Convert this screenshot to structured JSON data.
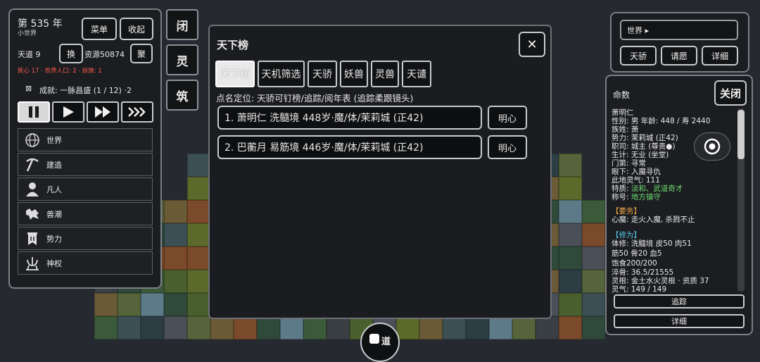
{
  "left": {
    "year": "第 535 年",
    "world_type": "小世界",
    "menu_btn": "菜单",
    "collapse_btn": "收起",
    "tiandao": "天道 9",
    "swap_btn": "换",
    "resources": "资源50874",
    "gather_btn": "聚",
    "status_line": "民心 17 · 世界人口: 2 · 妖族: 1",
    "achievement_icon": "⊠",
    "achievement": "成就: 一脉昌盛 (1 / 12) ·2",
    "menu_items": [
      {
        "label": "世界",
        "icon": "globe-icon"
      },
      {
        "label": "建造",
        "icon": "pickaxe-icon"
      },
      {
        "label": "凡人",
        "icon": "person-icon"
      },
      {
        "label": "兽潮",
        "icon": "wolf-icon"
      },
      {
        "label": "势力",
        "icon": "banner-icon"
      },
      {
        "label": "神权",
        "icon": "trident-icon"
      }
    ]
  },
  "side_buttons": [
    "闭",
    "灵",
    "筑"
  ],
  "modal": {
    "title": "天下榜",
    "close": "✕",
    "tabs": [
      "天下榜",
      "天机筛选",
      "天骄",
      "妖兽",
      "灵兽",
      "天谴"
    ],
    "subtitle": "点名定位: 天骄可钉榜/追踪/阅年表 (追踪柔跟镜头)",
    "entries": [
      {
        "text": "1. 萧明仁  洗髓境  448岁·魔/体/茉莉城 (正42)",
        "action": "明心"
      },
      {
        "text": "2. 巴蘅月  易筋境  446岁·魔/体/茉莉城 (正42)",
        "action": "明心"
      }
    ]
  },
  "right_top": {
    "world_select": "世界 ▸",
    "buttons": [
      "天骄",
      "请愿",
      "详细"
    ]
  },
  "right_panel": {
    "title": "命数",
    "close": "关闭",
    "name": "萧明仁",
    "lines": [
      "性别: 男   年龄: 448 / 寿 2440",
      "族姓: 萧",
      "势力: 茉莉城 (正42)",
      "职司: 城主 (尊贵●)",
      "生计: 无业 (坐堂)",
      "门第: 寻常",
      "眼下: 入魔寻仇",
      "此地灵气: 111"
    ],
    "trait_label": "特质: ",
    "trait_value": "淡和、武道奇才",
    "title_label": "称号: ",
    "title_value": "地方镇守",
    "task_header": "【要务】",
    "task": "心魔: 走火入魔, 杀戮不止",
    "cult_header": "【修为】",
    "cult_lines": [
      "体修: 洗髓境   皮50  肉51",
      "筋50  骨20  血5",
      "饱食200/200",
      "淬骨: 36.5/21555",
      "灵根: 金土水火灵根 · 资质 37",
      "灵气: 149 / 149"
    ],
    "track_btn": "追踪",
    "detail_btn": "详细"
  },
  "bottom_dial": "道",
  "colors": {
    "accent_green": "#6fdc6f",
    "accent_orange": "#f0a848",
    "accent_cyan": "#58c8e8",
    "status_red": "#ff5a4a"
  }
}
